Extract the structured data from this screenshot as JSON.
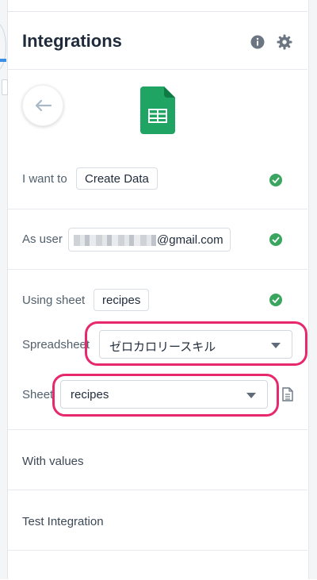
{
  "header": {
    "title": "Integrations"
  },
  "icons": {
    "info": "info-icon",
    "settings": "gear-icon",
    "back": "arrow-left-icon",
    "logo": "google-sheets-icon",
    "status": "check-circle-icon",
    "sheet_preview": "document-icon"
  },
  "colors": {
    "check": "#3aa55f",
    "highlight": "#e8286d",
    "sheets_green": "#1fa463",
    "accent": "#3a8ee6"
  },
  "action_row": {
    "label": "I want to",
    "value": "Create Data"
  },
  "user_row": {
    "label": "As user",
    "email_suffix": "@gmail.com"
  },
  "sheet_row": {
    "label": "Using sheet",
    "value": "recipes"
  },
  "spreadsheet_field": {
    "label": "Spreadsheet",
    "value": "ゼロカロリースキル"
  },
  "sheet_field": {
    "label": "Sheet",
    "value": "recipes"
  },
  "sections": {
    "with_values": "With values",
    "test_integration": "Test Integration"
  }
}
